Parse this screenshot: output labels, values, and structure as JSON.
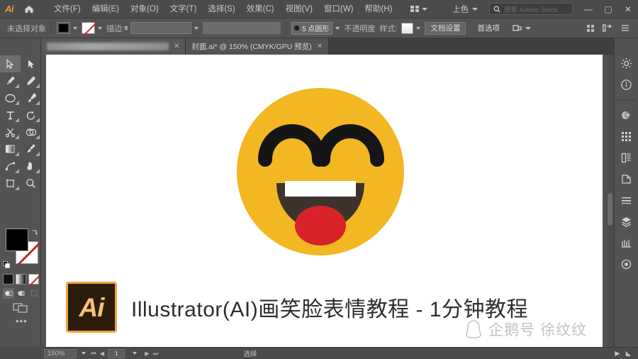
{
  "app": {
    "name": "Adobe Illustrator",
    "logo_text": "Ai"
  },
  "titlebar": {
    "home_icon": "home-icon",
    "menus": [
      {
        "label": "文件(F)"
      },
      {
        "label": "编辑(E)"
      },
      {
        "label": "对象(O)"
      },
      {
        "label": "文字(T)"
      },
      {
        "label": "选择(S)"
      },
      {
        "label": "效果(C)"
      },
      {
        "label": "视图(V)"
      },
      {
        "label": "窗口(W)"
      },
      {
        "label": "帮助(H)"
      }
    ],
    "arrange_documents_icon": "grid-arrange-icon",
    "workspace_label": "上色",
    "search_placeholder": "搜索 Adobe Stock",
    "minimize_label": "—",
    "maximize_label": "▢",
    "close_label": "✕"
  },
  "optionsbar": {
    "no_selection_label": "未选择对象",
    "fill_color": "#000000",
    "stroke_color": "none",
    "stroke_label": "描边:",
    "stroke_weight_value": "",
    "stroke_style_value": "",
    "stroke_profile_label": "5 点圆形",
    "opacity_label": "不透明度",
    "style_label": "样式:",
    "document_setup_label": "文档设置",
    "preferences_label": "首选项",
    "align_icon": "align-icon",
    "transform_icon": "transform-icon",
    "menu_icon": "panel-menu-icon"
  },
  "toolbar": {
    "tools": [
      {
        "name": "selection-tool",
        "selected": true
      },
      {
        "name": "direct-selection-tool",
        "selected": false
      },
      {
        "name": "pen-tool",
        "selected": false
      },
      {
        "name": "curvature-tool",
        "selected": false
      },
      {
        "name": "ellipse-tool",
        "selected": false
      },
      {
        "name": "paintbrush-tool",
        "selected": false
      },
      {
        "name": "type-tool",
        "selected": false
      },
      {
        "name": "rotate-tool",
        "selected": false
      },
      {
        "name": "scissors-tool",
        "selected": false
      },
      {
        "name": "shape-builder-tool",
        "selected": false
      },
      {
        "name": "gradient-tool",
        "selected": false
      },
      {
        "name": "eyedropper-tool",
        "selected": false
      },
      {
        "name": "free-transform-tool",
        "selected": false
      },
      {
        "name": "hand-tool",
        "selected": false
      },
      {
        "name": "artboard-tool",
        "selected": false
      },
      {
        "name": "zoom-tool",
        "selected": false
      }
    ],
    "fill_swatch": "#000000",
    "stroke_swatch": "none",
    "color_modes": [
      "color-swatch",
      "gradient-swatch",
      "none-swatch"
    ],
    "draw_modes": [
      "draw-normal",
      "draw-behind",
      "draw-inside"
    ],
    "screen_mode_icon": "screen-mode-icon",
    "more_tools_label": "•••"
  },
  "tabs": [
    {
      "title": "",
      "blurred": true,
      "active": false
    },
    {
      "title": "封面.ai* @ 150% (CMYK/GPU 预览)",
      "blurred": false,
      "active": true
    }
  ],
  "artwork": {
    "face_color": "#f3b724",
    "eye_color": "#1a1a1a",
    "mouth_color": "#3b332c",
    "teeth_color": "#ffffff",
    "tongue_color": "#d8222a",
    "badge_text": "Ai",
    "badge_bg": "#2b1c0c",
    "badge_border": "#f0a23c",
    "title": "Illustrator(AI)画笑脸表情教程 - 1分钟教程",
    "watermark_text": "企鹅号 徐纹纹"
  },
  "dock": {
    "items": [
      {
        "name": "properties-panel-icon"
      },
      {
        "name": "info-panel-icon"
      },
      {
        "name": "color-panel-icon"
      },
      {
        "name": "swatches-panel-icon"
      },
      {
        "name": "brushes-panel-icon"
      },
      {
        "name": "symbols-panel-icon"
      },
      {
        "name": "stroke-panel-icon"
      },
      {
        "name": "layers-panel-icon"
      },
      {
        "name": "libraries-panel-icon"
      },
      {
        "name": "appearance-panel-icon"
      }
    ]
  },
  "statusbar": {
    "zoom_level": "150%",
    "page_number": "1",
    "status_text": "选择",
    "first_page_icon": "first-page-icon",
    "prev_page_icon": "prev-page-icon",
    "next_page_icon": "next-page-icon",
    "last_page_icon": "last-page-icon",
    "play_icon": "play-icon"
  }
}
